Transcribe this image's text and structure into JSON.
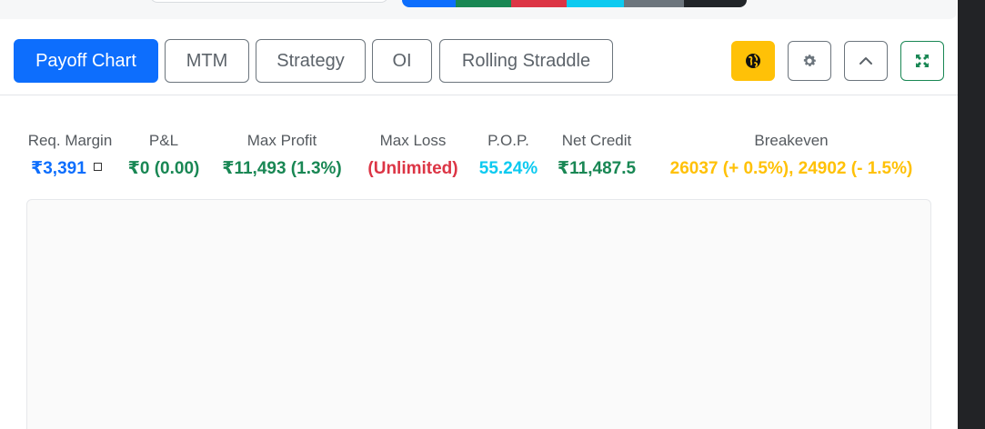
{
  "tabs": [
    {
      "label": "Payoff Chart",
      "active": true
    },
    {
      "label": "MTM",
      "active": false
    },
    {
      "label": "Strategy",
      "active": false
    },
    {
      "label": "OI",
      "active": false
    },
    {
      "label": "Rolling Straddle",
      "active": false
    }
  ],
  "icons": {
    "globe": "globe-icon",
    "settings": "gear-icon",
    "collapse": "chevron-up-icon",
    "fullscreen": "expand-icon"
  },
  "stats": {
    "req_margin": {
      "label": "Req. Margin",
      "value": "₹3,391",
      "color": "#0d6efd"
    },
    "pnl": {
      "label": "P&L",
      "value": "₹0 (0.00)",
      "color": "#198754"
    },
    "max_profit": {
      "label": "Max Profit",
      "value": "₹11,493 (1.3%)",
      "color": "#198754"
    },
    "max_loss": {
      "label": "Max Loss",
      "value": "(Unlimited)",
      "color": "#dc3545"
    },
    "pop": {
      "label": "P.O.P.",
      "value": "55.24%",
      "color": "#0dcaf0"
    },
    "net_credit": {
      "label": "Net Credit",
      "value": "₹11,487.5",
      "color": "#198754"
    },
    "breakeven": {
      "label": "Breakeven",
      "value": "26037 (+ 0.5%), 24902 (- 1.5%)",
      "color": "#ffc107"
    }
  },
  "colors": {
    "primary": "#0d6efd",
    "success": "#198754",
    "danger": "#dc3545",
    "info": "#0dcaf0",
    "warning": "#ffc107",
    "secondary": "#6c757d",
    "dark": "#212529"
  }
}
